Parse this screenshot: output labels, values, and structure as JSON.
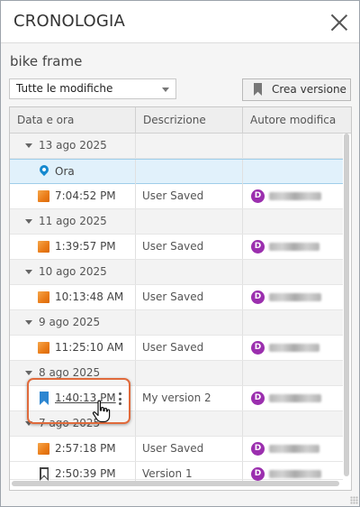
{
  "window": {
    "title": "CRONOLOGIA",
    "close_icon": "close-icon"
  },
  "document_name": "bike frame",
  "filter": {
    "selected": "Tutte le modifiche"
  },
  "create_version": {
    "label": "Crea versione",
    "icon": "bookmark-icon"
  },
  "table": {
    "columns": [
      "Data e ora",
      "Descrizione",
      "Autore modifica"
    ],
    "groups": [
      {
        "date": "13 ago 2025",
        "entries": [
          {
            "icon": "location-pin-icon",
            "time": "Ora",
            "description": "",
            "author_initial": "",
            "selected": true
          },
          {
            "icon": "cube-icon",
            "time": "7:04:52 PM",
            "description": "User Saved",
            "author_initial": "D"
          }
        ]
      },
      {
        "date": "11 ago 2025",
        "entries": [
          {
            "icon": "cube-icon",
            "time": "1:39:57 PM",
            "description": "User Saved",
            "author_initial": "D"
          }
        ]
      },
      {
        "date": "10 ago 2025",
        "entries": [
          {
            "icon": "cube-icon",
            "time": "10:13:48 AM",
            "description": "User Saved",
            "author_initial": "D"
          }
        ]
      },
      {
        "date": "9 ago 2025",
        "entries": [
          {
            "icon": "cube-icon",
            "time": "11:25:10 AM",
            "description": "User Saved",
            "author_initial": "D"
          }
        ]
      },
      {
        "date": "8 ago 2025",
        "entries": [
          {
            "icon": "bookmark-filled-icon",
            "time": "1:40:13 PM",
            "description": "My version 2",
            "author_initial": "D",
            "has_menu": true
          }
        ]
      },
      {
        "date": "7 ago 2025",
        "entries": [
          {
            "icon": "cube-icon",
            "time": "2:57:18 PM",
            "description": "User Saved",
            "author_initial": "D"
          },
          {
            "icon": "bookmark-outline-icon",
            "time": "2:50:39 PM",
            "description": "Version 1",
            "author_initial": "D"
          }
        ]
      }
    ]
  },
  "colors": {
    "accent_blue": "#1689cf",
    "avatar": "#9b2fae",
    "highlight": "#e06a3b",
    "selected_row": "#e1f1fb"
  }
}
